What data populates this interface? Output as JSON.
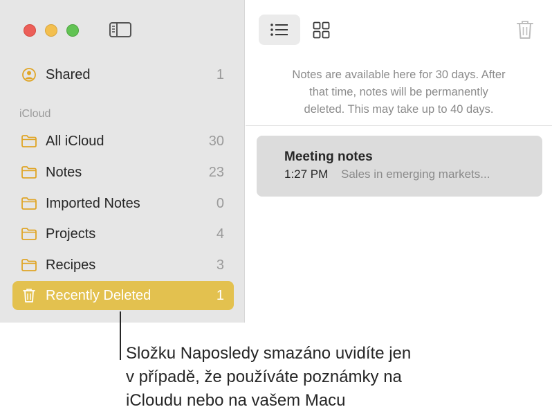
{
  "sidebar": {
    "shared": {
      "label": "Shared",
      "count": "1"
    },
    "section_title": "iCloud",
    "folders": [
      {
        "label": "All iCloud",
        "count": "30"
      },
      {
        "label": "Notes",
        "count": "23"
      },
      {
        "label": "Imported Notes",
        "count": "0"
      },
      {
        "label": "Projects",
        "count": "4"
      },
      {
        "label": "Recipes",
        "count": "3"
      },
      {
        "label": "Recently Deleted",
        "count": "1",
        "selected": true
      }
    ]
  },
  "toolbar": {
    "list_view_icon": "list-view-icon",
    "gallery_view_icon": "gallery-view-icon",
    "delete_icon": "trash-icon"
  },
  "main": {
    "banner_lines": [
      "Notes are available here for 30 days. After",
      "that time, notes will be permanently",
      "deleted. This may take up to 40 days."
    ],
    "note": {
      "title": "Meeting notes",
      "time": "1:27 PM",
      "preview": "Sales in emerging markets..."
    }
  },
  "callout_lines": [
    "Složku Naposledy smazáno uvidíte jen",
    "v případě, že používáte poznámky na",
    "iCloudu nebo na vašem Macu"
  ],
  "colors": {
    "accent": "#e3c14f",
    "folder_icon": "#e0a526",
    "sidebar_bg": "#e6e6e6",
    "note_selected": "#dcdcdc"
  }
}
